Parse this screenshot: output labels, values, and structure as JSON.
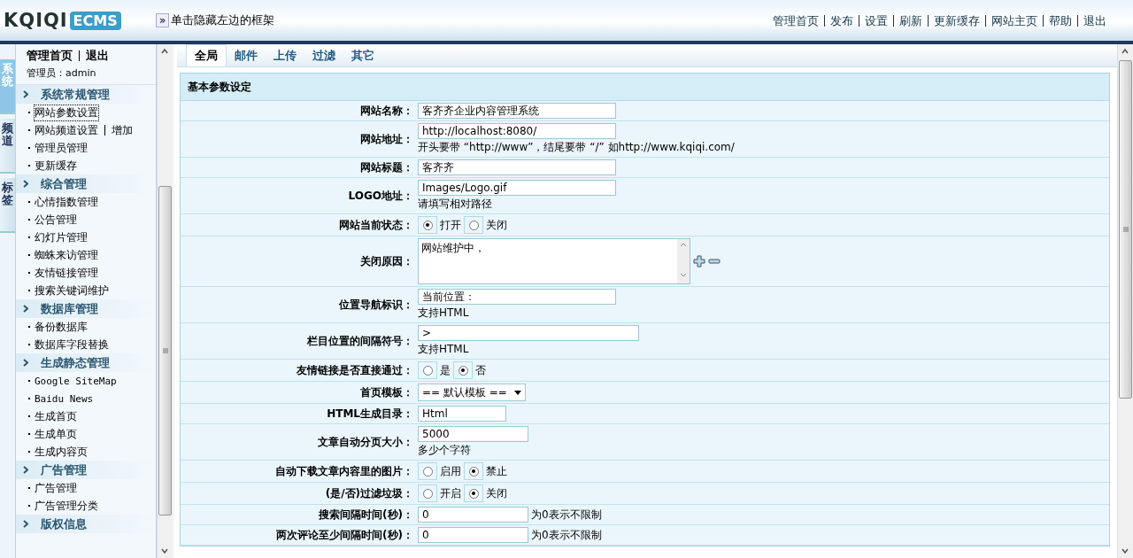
{
  "header": {
    "logo": {
      "brand": "KQIQI",
      "product": "ECMS"
    },
    "toggle": {
      "icon": "»",
      "label": "单击隐藏左边的框架"
    },
    "links": [
      "管理首页",
      "发布",
      "设置",
      "刷新",
      "更新缓存",
      "网站主页",
      "帮助",
      "退出"
    ]
  },
  "side_tabs": [
    {
      "label": "系统",
      "selected": true
    },
    {
      "label": "频道",
      "selected": false
    },
    {
      "label": "标签",
      "selected": false
    }
  ],
  "sidebar": {
    "top_links": [
      "管理首页",
      "退出"
    ],
    "admin": "管理员：admin",
    "sections": [
      {
        "title": "系统常规管理",
        "items": [
          {
            "label": "网站参数设置",
            "selected": true
          },
          {
            "label": "网站频道设置",
            "extra": "增加",
            "selected": false
          },
          {
            "label": "管理员管理",
            "selected": false
          },
          {
            "label": "更新缓存",
            "selected": false
          }
        ]
      },
      {
        "title": "综合管理",
        "items": [
          {
            "label": "心情指数管理",
            "selected": false
          },
          {
            "label": "公告管理",
            "selected": false
          },
          {
            "label": "幻灯片管理",
            "selected": false
          },
          {
            "label": "蜘蛛来访管理",
            "selected": false
          },
          {
            "label": "友情链接管理",
            "selected": false
          },
          {
            "label": "搜索关键词维护",
            "selected": false
          }
        ]
      },
      {
        "title": "数据库管理",
        "items": [
          {
            "label": "备份数据库",
            "selected": false
          },
          {
            "label": "数据库字段替换",
            "selected": false
          }
        ]
      },
      {
        "title": "生成静态管理",
        "items": [
          {
            "label": "Google SiteMap",
            "selected": false
          },
          {
            "label": "Baidu News",
            "selected": false
          },
          {
            "label": "生成首页",
            "selected": false
          },
          {
            "label": "生成单页",
            "selected": false
          },
          {
            "label": "生成内容页",
            "selected": false
          }
        ]
      },
      {
        "title": "广告管理",
        "items": [
          {
            "label": "广告管理",
            "selected": false
          },
          {
            "label": "广告管理分类",
            "selected": false
          }
        ]
      },
      {
        "title": "版权信息"
      }
    ]
  },
  "tabs": [
    {
      "label": "全局",
      "selected": true
    },
    {
      "label": "邮件",
      "selected": false
    },
    {
      "label": "上传",
      "selected": false
    },
    {
      "label": "过滤",
      "selected": false
    },
    {
      "label": "其它",
      "selected": false
    }
  ],
  "panel": {
    "title": "基本参数设定",
    "rows": [
      {
        "kind": "text",
        "label": "网站名称：",
        "value": "客齐齐企业内容管理系统"
      },
      {
        "kind": "text",
        "label": "网站地址：",
        "value": "http://localhost:8080/",
        "hint": "开头要带 “http://www”，结尾要带 “/” 如http://www.kqiqi.com/"
      },
      {
        "kind": "text",
        "label": "网站标题：",
        "value": "客齐齐"
      },
      {
        "kind": "text",
        "label": "LOGO地址：",
        "value": "Images/Logo.gif",
        "hint": "请填写相对路径"
      },
      {
        "kind": "radio",
        "label": "网站当前状态：",
        "options": [
          {
            "label": "打开",
            "selected": true
          },
          {
            "label": "关闭",
            "selected": false
          }
        ]
      },
      {
        "kind": "textarea",
        "label": "关闭原因：",
        "value": "网站维护中，"
      },
      {
        "kind": "text",
        "label": "位置导航标识：",
        "value": "当前位置：",
        "hint": "支持HTML"
      },
      {
        "kind": "text",
        "label": "栏目位置的间隔符号：",
        "value": ">",
        "hint": "支持HTML"
      },
      {
        "kind": "radio",
        "label": "友情链接是否直接通过：",
        "options": [
          {
            "label": "是",
            "selected": false
          },
          {
            "label": "否",
            "selected": true
          }
        ]
      },
      {
        "kind": "select",
        "label": "首页模板：",
        "value": "== 默认模板 =="
      },
      {
        "kind": "text",
        "label": "HTML生成目录：",
        "value": "Html"
      },
      {
        "kind": "text",
        "label": "文章自动分页大小：",
        "value": "5000",
        "hint": "多少个字符"
      },
      {
        "kind": "radio",
        "label": "自动下载文章内容里的图片：",
        "options": [
          {
            "label": "启用",
            "selected": false
          },
          {
            "label": "禁止",
            "selected": true
          }
        ]
      },
      {
        "kind": "radio",
        "label": "(是/否)过滤垃圾：",
        "options": [
          {
            "label": "开启",
            "selected": false
          },
          {
            "label": "关闭",
            "selected": true
          }
        ]
      },
      {
        "kind": "text",
        "label": "搜索间隔时间(秒)：",
        "value": "0",
        "suffix": "为0表示不限制"
      },
      {
        "kind": "text",
        "label": "两次评论至少间隔时间(秒)：",
        "value": "0",
        "suffix": "为0表示不限制"
      }
    ]
  }
}
